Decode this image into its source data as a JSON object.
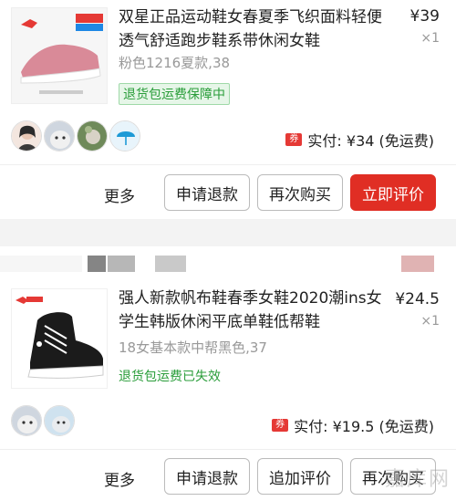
{
  "coupon_glyph": "券",
  "orders": [
    {
      "title": "双星正品运动鞋女春夏季飞织面料轻便透气舒适跑步鞋系带休闲女鞋",
      "price": "¥39",
      "qty": "×1",
      "sku": "粉色1216夏款,38",
      "badge": "退货包运费保障中",
      "paid": "实付: ¥34 (免运费)",
      "actions": {
        "more": "更多",
        "b1": "申请退款",
        "b2": "再次购买",
        "b3": "立即评价"
      }
    },
    {
      "title": "强人新款帆布鞋春季女鞋2020潮ins女学生韩版休闲平底单鞋低帮鞋",
      "price": "¥24.5",
      "qty": "×1",
      "sku": "18女基本款中帮黑色,37",
      "badge": "退货包运费已失效",
      "paid": "实付: ¥19.5 (免运费)",
      "actions": {
        "more": "更多",
        "b1": "申请退款",
        "b2": "追加评价",
        "b3": "再次购买"
      }
    }
  ],
  "watermark": "嘉库网",
  "colors": {
    "accent": "#e02e24",
    "guarantee_green": "#2a9d3a",
    "muted": "#999999",
    "separator": "#f3f3f3"
  }
}
